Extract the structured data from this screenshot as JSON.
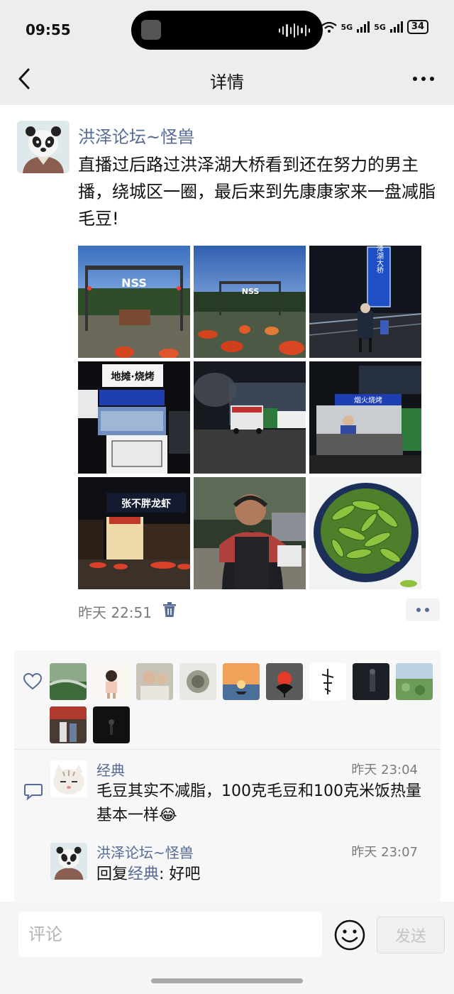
{
  "status_bar": {
    "time": "09:55",
    "network_1": "5G",
    "network_2": "5G",
    "battery": "34"
  },
  "header": {
    "title": "详情",
    "back_icon": "chevron-left-icon",
    "more_icon": "more-dots-icon"
  },
  "post": {
    "author": "洪泽论坛~怪兽",
    "text": "直播过后路过洪泽湖大桥看到还在努力的男主播，绕城区一圈，最后来到先康康家来一盘减脂毛豆!",
    "photos": [
      {
        "sign": "NSS"
      },
      {
        "sign": "NSS"
      },
      {
        "sign": "洪泽湖大桥"
      },
      {
        "sign": "地摊·烧烤"
      },
      {
        "sign": ""
      },
      {
        "sign": "烟火烧烤"
      },
      {
        "sign": "张不胖龙虾"
      },
      {
        "sign": ""
      },
      {
        "sign": ""
      }
    ],
    "time": "昨天 22:51",
    "delete_icon": "trash-icon"
  },
  "likes": {
    "icon": "heart-icon",
    "count": 11
  },
  "comments": [
    {
      "name": "经典",
      "time": "昨天 23:04",
      "text": "毛豆其实不减脂，100克毛豆和100克米饭热量基本一样😂"
    },
    {
      "name": "洪泽论坛~怪兽",
      "time": "昨天 23:07",
      "reply_prefix": "回复",
      "reply_to": "经典",
      "reply_text": ": 好吧"
    }
  ],
  "input": {
    "placeholder": "评论",
    "send_label": "发送",
    "emoji_icon": "smile-icon"
  },
  "colors": {
    "link": "#576b95",
    "header_bg": "#ededed"
  }
}
